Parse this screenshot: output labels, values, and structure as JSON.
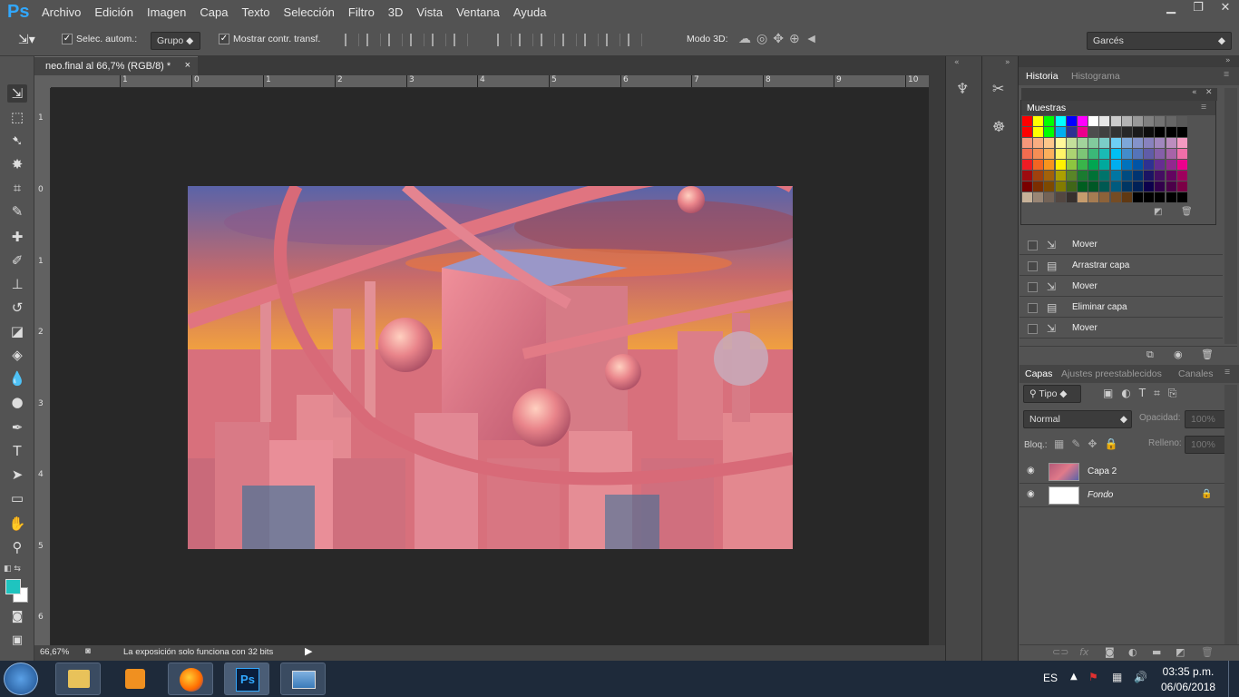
{
  "app": {
    "logo": "Ps"
  },
  "menu": [
    "Archivo",
    "Edición",
    "Imagen",
    "Capa",
    "Texto",
    "Selección",
    "Filtro",
    "3D",
    "Vista",
    "Ventana",
    "Ayuda"
  ],
  "window_controls": {
    "minimize": "▁",
    "restore": "❐",
    "close": "✕"
  },
  "options": {
    "auto_select_label": "Selec. autom.:",
    "auto_select_value": "Grupo",
    "show_transform_label": "Mostrar contr. transf.",
    "mode3d_label": "Modo 3D:",
    "workspace": "Garcés"
  },
  "document": {
    "tab_title": "neo.final al 66,7% (RGB/8) *",
    "tab_close": "×",
    "ruler_h": [
      "1",
      "0",
      "1",
      "2",
      "3",
      "4",
      "5",
      "6",
      "7",
      "8",
      "9",
      "10"
    ],
    "ruler_v": [
      "1",
      "0",
      "1",
      "2",
      "3",
      "4",
      "5",
      "6"
    ],
    "zoom": "66,67%",
    "status_message": "La exposición solo funciona con 32 bits"
  },
  "panels": {
    "history_tab": "Historia",
    "histogram_tab": "Histograma",
    "swatches_title": "Muestras",
    "history_items": [
      {
        "label": "Mover",
        "icon": "move-icon"
      },
      {
        "label": "Arrastrar capa",
        "icon": "document-icon"
      },
      {
        "label": "Mover",
        "icon": "move-icon"
      },
      {
        "label": "Eliminar capa",
        "icon": "document-icon"
      },
      {
        "label": "Mover",
        "icon": "move-icon"
      }
    ],
    "layers_tab": "Capas",
    "presets_tab": "Ajustes preestablecidos",
    "channels_tab": "Canales",
    "filter_kind": "Tipo",
    "blend_mode": "Normal",
    "opacity_label": "Opacidad:",
    "opacity_value": "100%",
    "lock_label": "Bloq.:",
    "fill_label": "Relleno:",
    "fill_value": "100%",
    "layers": [
      {
        "name": "Capa 2"
      },
      {
        "name": "Fondo"
      }
    ]
  },
  "swatch_colors": [
    [
      "#ff0000",
      "#ffff00",
      "#00ff00",
      "#00ffff",
      "#0000ff",
      "#ff00ff",
      "#ffffff",
      "#e6e6e6",
      "#cccccc",
      "#b3b3b3",
      "#999999",
      "#808080",
      "#737373",
      "#666666",
      "#595959"
    ],
    [
      "#ff0000",
      "#ffff00",
      "#00ff00",
      "#00aeef",
      "#2e3192",
      "#ec008c",
      "#4d4d4d",
      "#404040",
      "#333333",
      "#262626",
      "#1a1a1a",
      "#0d0d0d",
      "#000000",
      "#000000",
      "#000000"
    ],
    [
      "#f7977a",
      "#f9ad81",
      "#fdc68a",
      "#fff79a",
      "#c4df9b",
      "#a2d39c",
      "#82ca9d",
      "#7bcdc8",
      "#6ecff6",
      "#7ea7d8",
      "#8493ca",
      "#8882be",
      "#a187be",
      "#bc8dbf",
      "#f49ac2"
    ],
    [
      "#f26c4f",
      "#f68e55",
      "#fbaf5c",
      "#fff467",
      "#acd372",
      "#7cc576",
      "#3bb878",
      "#1abbb4",
      "#00bff3",
      "#438ccb",
      "#5574b9",
      "#605ca8",
      "#855fa8",
      "#a763a8",
      "#f06ea9"
    ],
    [
      "#ed1c24",
      "#f26522",
      "#f7941d",
      "#fff200",
      "#8dc63f",
      "#39b54a",
      "#00a651",
      "#00a99d",
      "#00aeef",
      "#0072bc",
      "#0054a6",
      "#2e3192",
      "#662d91",
      "#92278f",
      "#ec008c"
    ],
    [
      "#9e0b0f",
      "#a0410d",
      "#a36209",
      "#aba000",
      "#598527",
      "#1a7b30",
      "#007236",
      "#00746b",
      "#0076a3",
      "#004b80",
      "#003471",
      "#1b1464",
      "#440e62",
      "#630460",
      "#9e005d"
    ],
    [
      "#790000",
      "#7b2e00",
      "#7d4900",
      "#827b00",
      "#406618",
      "#005e20",
      "#005826",
      "#005952",
      "#005b7f",
      "#003663",
      "#002157",
      "#0d004c",
      "#32004b",
      "#4b0049",
      "#7b0046"
    ],
    [
      "#c7b299",
      "#998675",
      "#736357",
      "#534741",
      "#37302d",
      "#c69c6d",
      "#a67c52",
      "#8c6239",
      "#754c24",
      "#603913",
      "#000000",
      "#000000",
      "#000000",
      "#000000",
      "#000000"
    ]
  ],
  "taskbar": {
    "lang": "ES",
    "time": "03:35 p.m.",
    "date": "06/06/2018"
  }
}
